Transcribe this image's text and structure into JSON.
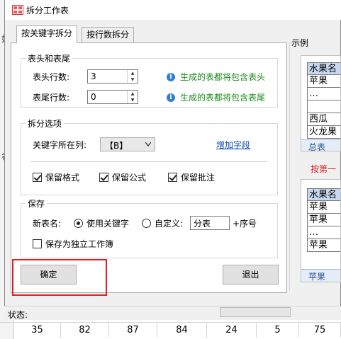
{
  "dialog": {
    "title": "拆分工作表",
    "tabs": [
      {
        "label": "按关键字拆分",
        "active": true
      },
      {
        "label": "按行数拆分",
        "active": false
      }
    ],
    "header_footer": {
      "group_title": "表头和表尾",
      "header_rows_label": "表头行数:",
      "header_rows_value": "3",
      "header_note": "生成的表都将包含表头",
      "footer_rows_label": "表尾行数:",
      "footer_rows_value": "0",
      "footer_note": "生成的表都将包含表尾"
    },
    "split_options": {
      "group_title": "拆分选项",
      "key_column_label": "关键字所在列:",
      "key_column_value": "【B】",
      "add_field_link": "增加字段",
      "keep_format": {
        "label": "保留格式",
        "checked": true
      },
      "keep_formula": {
        "label": "保留公式",
        "checked": true
      },
      "keep_comment": {
        "label": "保留批注",
        "checked": true
      }
    },
    "save": {
      "group_title": "保存",
      "new_sheet_name_label": "新表名:",
      "use_keyword": {
        "label": "使用关键字",
        "selected": true
      },
      "custom": {
        "label": "自定义:",
        "selected": false
      },
      "custom_value": "分表",
      "seq_suffix": "+序号",
      "save_independent": {
        "label": "保存为独立工作簿",
        "checked": false
      }
    },
    "ok_button": "确定",
    "exit_button": "退出",
    "status_label": "状态:"
  },
  "example": {
    "title": "示例",
    "top": {
      "header": "水果名",
      "rows": [
        "苹果",
        "…",
        "",
        "西瓜",
        "火龙果"
      ],
      "sheet_tab": "总表"
    },
    "caption": "按第一",
    "bottom": {
      "header": "水果名",
      "rows": [
        "苹果",
        "苹果",
        "…",
        "苹果"
      ],
      "sheet_tab": "苹果"
    }
  },
  "background": {
    "left_fragments": [
      "如",
      "名"
    ],
    "bottom_row": [
      "35",
      "82",
      "87",
      "84",
      "24",
      "5",
      "75"
    ]
  },
  "colors": {
    "accent_green": "#1b8a1b",
    "link_blue": "#0645ad",
    "highlight_red": "#e02020",
    "info_blue": "#2f7fd6"
  }
}
